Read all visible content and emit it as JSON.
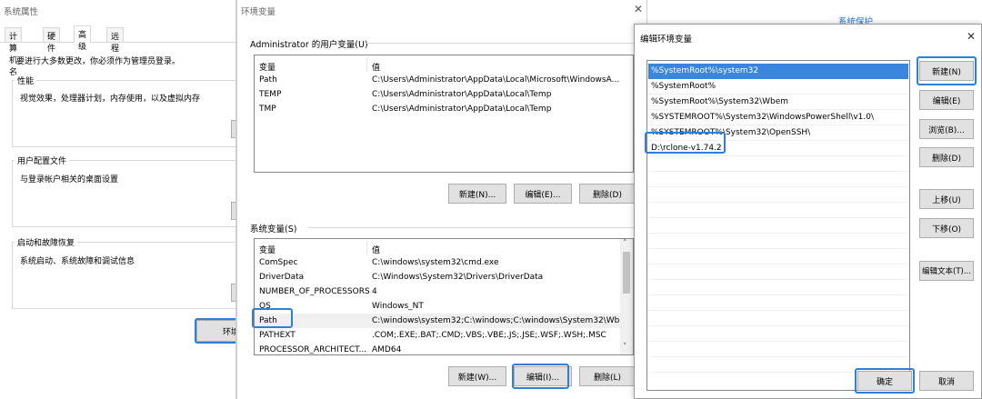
{
  "sysprops": {
    "title": "系统属性",
    "tabs": [
      "计算机名",
      "硬件",
      "高级",
      "远程"
    ],
    "admin_note": "要进行大多数更改，你必须作为管理员登录。",
    "performance": {
      "label": "性能",
      "desc": "视觉效果，处理器计划，内存使用，以及虚拟内存"
    },
    "profiles": {
      "label": "用户配置文件",
      "desc": "与登录帐户相关的桌面设置"
    },
    "startup": {
      "label": "启动和故障恢复",
      "desc": "系统启动、系统故障和调试信息"
    },
    "env_button": "环境"
  },
  "envvars": {
    "title": "环境变量",
    "user_section": "Administrator 的用户变量(U)",
    "headers": {
      "var": "变量",
      "value": "值"
    },
    "user_rows": [
      {
        "name": "Path",
        "value": "C:\\Users\\Administrator\\AppData\\Local\\Microsoft\\WindowsA..."
      },
      {
        "name": "TEMP",
        "value": "C:\\Users\\Administrator\\AppData\\Local\\Temp"
      },
      {
        "name": "TMP",
        "value": "C:\\Users\\Administrator\\AppData\\Local\\Temp"
      }
    ],
    "user_buttons": {
      "new": "新建(N)...",
      "edit": "编辑(E)...",
      "delete": "删除(D)"
    },
    "system_section": "系统变量(S)",
    "system_rows": [
      {
        "name": "ComSpec",
        "value": "C:\\windows\\system32\\cmd.exe"
      },
      {
        "name": "DriverData",
        "value": "C:\\Windows\\System32\\Drivers\\DriverData"
      },
      {
        "name": "NUMBER_OF_PROCESSORS",
        "value": "4"
      },
      {
        "name": "OS",
        "value": "Windows_NT"
      },
      {
        "name": "Path",
        "value": "C:\\windows\\system32;C:\\windows;C:\\windows\\System32\\Wbe..."
      },
      {
        "name": "PATHEXT",
        "value": ".COM;.EXE;.BAT;.CMD;.VBS;.VBE;.JS;.JSE;.WSF;.WSH;.MSC"
      },
      {
        "name": "PROCESSOR_ARCHITECT...",
        "value": "AMD64"
      }
    ],
    "system_buttons": {
      "new": "新建(W)...",
      "edit": "编辑(I)...",
      "delete": "删除(L)"
    }
  },
  "editenv": {
    "title": "编辑环境变量",
    "entries": [
      "%SystemRoot%\\system32",
      "%SystemRoot%",
      "%SystemRoot%\\System32\\Wbem",
      "%SYSTEMROOT%\\System32\\WindowsPowerShell\\v1.0\\",
      "%SYSTEMROOT%\\System32\\OpenSSH\\",
      "D:\\rclone-v1.74.2"
    ],
    "buttons": {
      "new": "新建(N)",
      "edit": "编辑(E)",
      "browse": "浏览(B)...",
      "delete": "删除(D)",
      "up": "上移(U)",
      "down": "下移(O)",
      "edit_text": "编辑文本(T)...",
      "ok": "确定",
      "cancel": "取消"
    }
  },
  "background": {
    "system_protection": "系统保护"
  },
  "colors": {
    "highlight": "#2f7fd7",
    "selection": "#3a86de",
    "link": "#1f6fd0"
  }
}
